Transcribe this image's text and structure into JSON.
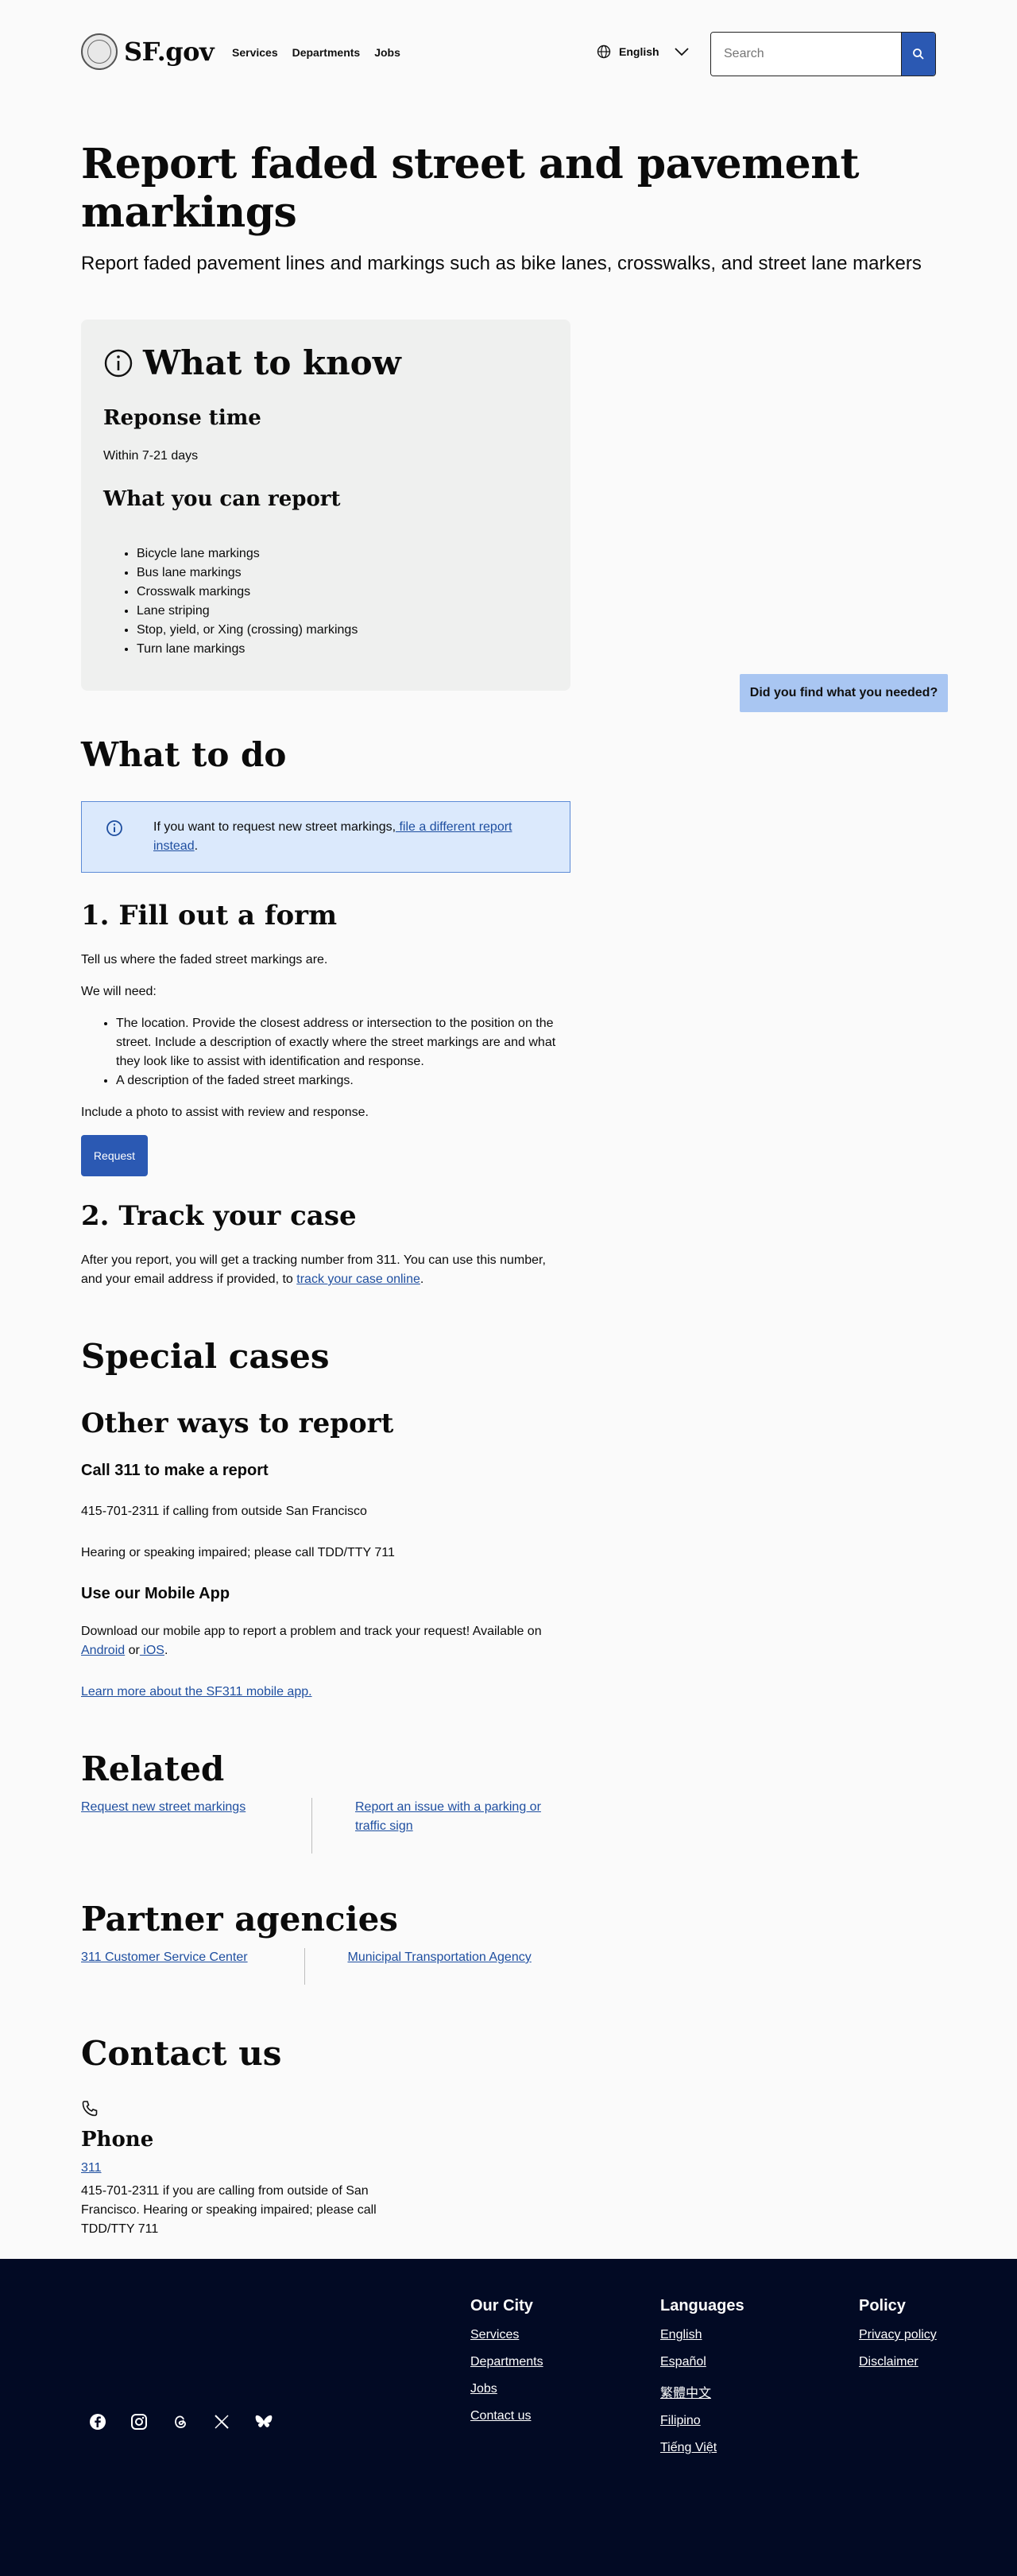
{
  "header": {
    "logo_text": "SF.gov",
    "nav": [
      "Services",
      "Departments",
      "Jobs"
    ],
    "language": "English",
    "search_placeholder": "Search"
  },
  "page": {
    "title": "Report faded street and pavement markings",
    "subtitle": "Report faded pavement lines and markings such as bike lanes, crosswalks, and street lane markers"
  },
  "know": {
    "title": "What to know",
    "response_heading": "Reponse time",
    "response_value": "Within 7-21 days",
    "report_heading": "What you can report",
    "report_items": [
      "Bicycle lane markings",
      "Bus lane markings",
      "Crosswalk markings",
      "Lane striping",
      "Stop, yield, or Xing (crossing) markings",
      "Turn lane markings"
    ]
  },
  "feedback_label": "Did you find what you needed?",
  "todo": {
    "title": "What to do",
    "callout_text": "If you want to request new street markings,",
    "callout_link": " file a different report instead",
    "callout_end": ".",
    "step1_title": "1. Fill out a form",
    "step1_intro": "Tell us where the faded street markings are.",
    "step1_need": "We will need:",
    "step1_items": [
      "The location. Provide the closest address or intersection to the position on the street. Include a description of exactly where the street markings are and what they look like to assist with identification and response.",
      "A description of the faded street markings."
    ],
    "step1_photo": "Include a photo to assist with review and response.",
    "request_button": "Request",
    "step2_title": "2. Track your case",
    "step2_text": "After you report, you will get a tracking number from 311. You can use this number, and your email address if provided, to ",
    "step2_link": "track your case online",
    "step2_end": "."
  },
  "special": {
    "title": "Special cases",
    "other_title": "Other ways to report",
    "call_heading": "Call 311 to make a report",
    "call_line1": "415-701-2311 if calling from outside San Francisco",
    "call_line2": "Hearing or speaking impaired; please call TDD/TTY 711",
    "app_heading": "Use our Mobile App",
    "app_text": "Download our mobile app to report a problem and track your request! Available on",
    "app_android": "Android",
    "app_or": " or",
    "app_ios": " iOS",
    "app_end": ".",
    "app_learn": "Learn more about the SF311 mobile app."
  },
  "related": {
    "title": "Related",
    "links": [
      "Request new street markings",
      "Report an issue with a parking or traffic sign"
    ]
  },
  "partners": {
    "title": "Partner agencies",
    "links": [
      "311 Customer Service Center",
      "Municipal Transportation Agency"
    ]
  },
  "contact": {
    "title": "Contact us",
    "phone_heading": "Phone",
    "phone_link": "311",
    "phone_text": "415-701-2311 if you are calling from outside of San Francisco. Hearing or speaking impaired; please call TDD/TTY 711"
  },
  "footer": {
    "city_heading": "Our City",
    "city_links": [
      "Services",
      "Departments",
      "Jobs",
      "Contact us"
    ],
    "lang_heading": "Languages",
    "lang_links": [
      "English",
      "Español",
      "繁體中文",
      "Filipino",
      "Tiếng Việt"
    ],
    "policy_heading": "Policy",
    "policy_links": [
      "Privacy policy",
      "Disclaimer"
    ]
  }
}
